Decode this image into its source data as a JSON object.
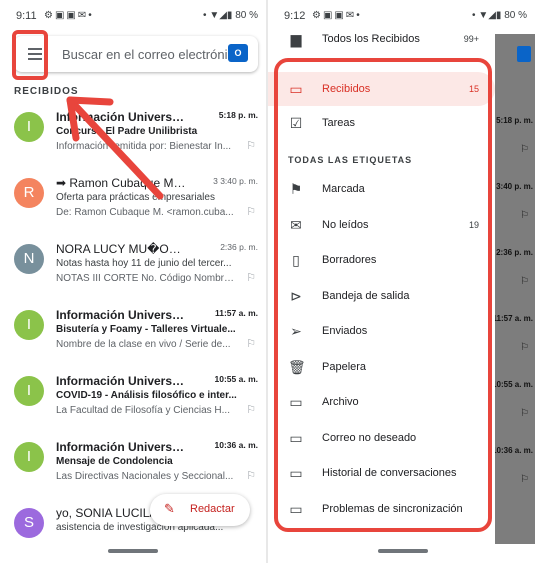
{
  "left": {
    "status": {
      "time": "9:11",
      "battery": "80 %"
    },
    "search_placeholder": "Buscar en el correo electrónico",
    "section": "RECIBIDOS",
    "emails": [
      {
        "avatar": "I",
        "color": "#8bc34a",
        "sender": "Información Universida...",
        "meta": "5:18 p. m.",
        "subject": "Concurso El Padre Unilibrista",
        "preview": "Información remitida por: Bienestar In...",
        "unread": true
      },
      {
        "avatar": "R",
        "color": "#f4845f",
        "sender": "➡ Ramon Cubaque M.,...",
        "meta": "3  3:40 p. m.",
        "subject": "Oferta para prácticas empresariales",
        "preview": "De: Ramon Cubaque M. <ramon.cuba...",
        "unread": false
      },
      {
        "avatar": "N",
        "color": "#78909c",
        "sender": "NORA LUCY MU�OZ ARTU...",
        "meta": "2:36 p. m.",
        "subject": "Notas hasta hoy 11 de junio del tercer...",
        "preview": "NOTAS III CORTE No. Código Nombre...",
        "unread": false
      },
      {
        "avatar": "I",
        "color": "#8bc34a",
        "sender": "Información Universida...",
        "meta": "11:57 a. m.",
        "subject": "Bisutería y Foamy - Talleres Virtuale...",
        "preview": "Nombre de la clase en vivo / Serie de...",
        "unread": true
      },
      {
        "avatar": "I",
        "color": "#8bc34a",
        "sender": "Información Universida...",
        "meta": "10:55 a. m.",
        "subject": "COVID-19 - Análisis filosófico e inter...",
        "preview": "La Facultad de Filosofía y Ciencias H...",
        "unread": true
      },
      {
        "avatar": "I",
        "color": "#8bc34a",
        "sender": "Información Universida...",
        "meta": "10:36 a. m.",
        "subject": "Mensaje de Condolencia",
        "preview": "Las Directivas Nacionales y Seccional...",
        "unread": true
      },
      {
        "avatar": "S",
        "color": "#9c6ade",
        "sender": "yo, SONIA LUCILA",
        "meta": "",
        "subject": "asistencia de investigacion aplicada...",
        "preview": "",
        "unread": false
      }
    ],
    "compose_label": "Redactar"
  },
  "right": {
    "status": {
      "time": "9:12",
      "battery": "80 %"
    },
    "all_inbox": {
      "label": "Todos los Recibidos",
      "count": "99+"
    },
    "inbox": {
      "label": "Recibidos",
      "count": "15"
    },
    "tasks": {
      "label": "Tareas"
    },
    "labels_header": "TODAS LAS ETIQUETAS",
    "items": [
      {
        "label": "Marcada",
        "count": ""
      },
      {
        "label": "No leídos",
        "count": "19"
      },
      {
        "label": "Borradores",
        "count": ""
      },
      {
        "label": "Bandeja de salida",
        "count": ""
      },
      {
        "label": "Enviados",
        "count": ""
      },
      {
        "label": "Papelera",
        "count": ""
      },
      {
        "label": "Archivo",
        "count": ""
      },
      {
        "label": "Correo no deseado",
        "count": ""
      },
      {
        "label": "Historial de conversaciones",
        "count": ""
      },
      {
        "label": "Problemas de sincronización",
        "count": ""
      }
    ],
    "shade_times": [
      "5:18 p. m.",
      "3:40 p. m.",
      "2:36 p. m.",
      "11:57 a. m.",
      "10:55 a. m.",
      "10:36 a. m."
    ]
  }
}
